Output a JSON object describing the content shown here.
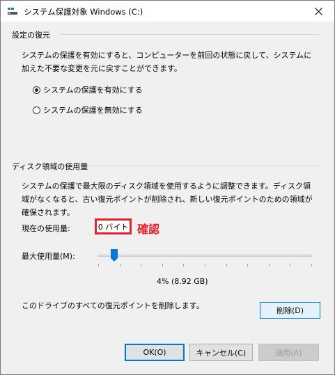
{
  "window": {
    "title": "システム保護対象 Windows (C:)",
    "icon": "system-drive-icon",
    "close_icon": "close-icon"
  },
  "restore_settings": {
    "group_title": "設定の復元",
    "description": "システムの保護を有効にすると、コンピューターを前回の状態に戻して、システムに加えた不要な変更を元に戻すことができます。",
    "options": [
      {
        "label": "システムの保護を有効にする",
        "checked": true
      },
      {
        "label": "システムの保護を無効にする",
        "checked": false
      }
    ]
  },
  "disk_usage": {
    "group_title": "ディスク領域の使用量",
    "description": "システムの保護で最大限のディスク領域を使用するように調整できます。ディスク領域がなくなると、古い復元ポイントが削除され、新しい復元ポイントのための領域が確保されます。",
    "current_usage_label": "現在の使用量:",
    "current_usage_value": "0 バイト",
    "annotation": "確認",
    "annotation_color": "#e8202a",
    "max_usage_label": "最大使用量(M):",
    "slider_fraction": 0.04,
    "slider_readout": "4% (8.92 GB)",
    "delete_text": "このドライブのすべての復元ポイントを削除します。",
    "delete_button": "削除(D)"
  },
  "footer": {
    "ok": "OK(O)",
    "cancel": "キャンセル(C)",
    "apply": "適用(A)"
  },
  "colors": {
    "accent": "#0078d7",
    "slider_thumb": "#0078d7"
  }
}
